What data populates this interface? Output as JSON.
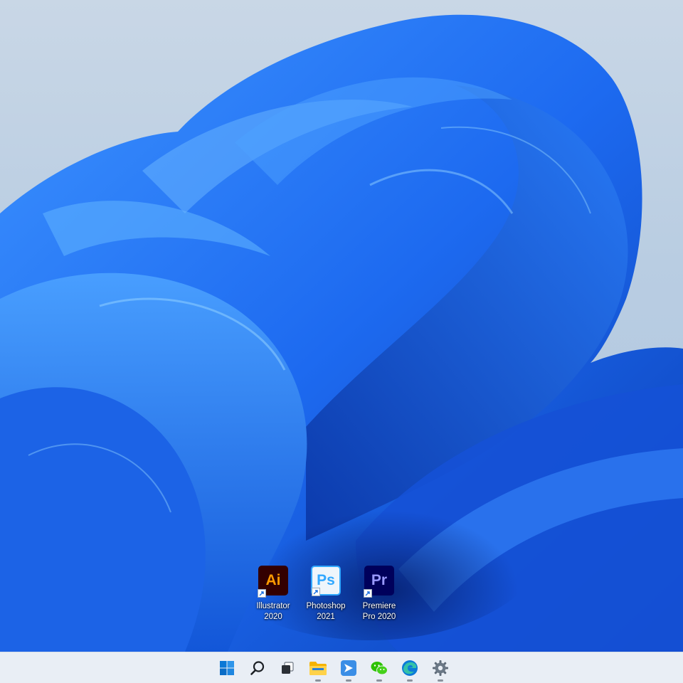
{
  "desktop": {
    "wallpaper": "Windows 11 Bloom (blue)",
    "icons": [
      {
        "id": "illustrator",
        "badge": "Ai",
        "label": "Illustrator\n2020",
        "bg": "#330000",
        "fg": "#ff9a00"
      },
      {
        "id": "photoshop",
        "badge": "Ps",
        "label": "Photoshop\n2021",
        "bg": "#eef5fb",
        "fg": "#31a8ff"
      },
      {
        "id": "premiere",
        "badge": "Pr",
        "label": "Premiere\nPro 2020",
        "bg": "#00005b",
        "fg": "#9999ff"
      }
    ]
  },
  "taskbar": {
    "items": [
      {
        "name": "start-button",
        "icon": "windows-logo-icon"
      },
      {
        "name": "search-button",
        "icon": "search-icon"
      },
      {
        "name": "task-view-button",
        "icon": "task-view-icon"
      },
      {
        "name": "file-explorer-button",
        "icon": "folder-icon"
      },
      {
        "name": "app-button",
        "icon": "app-icon"
      },
      {
        "name": "wechat-button",
        "icon": "wechat-icon"
      },
      {
        "name": "edge-button",
        "icon": "edge-icon"
      },
      {
        "name": "settings-button",
        "icon": "gear-icon"
      }
    ]
  },
  "colors": {
    "sky": "#c9d7e6",
    "bloom_primary": "#1f6ff0",
    "bloom_dark": "#0a3fb8",
    "taskbar_bg": "#e9eef5",
    "windows_blue": "#0078d4"
  }
}
